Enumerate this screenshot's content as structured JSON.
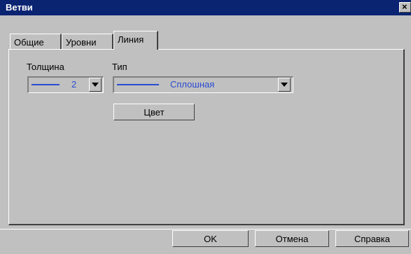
{
  "window": {
    "title": "Ветви",
    "close_glyph": "×"
  },
  "tabs": [
    {
      "label": "Общие",
      "active": false
    },
    {
      "label": "Уровни",
      "active": false
    },
    {
      "label": "Линия",
      "active": true
    }
  ],
  "line_settings": {
    "thickness_label": "Толщина",
    "thickness_value": "2",
    "type_label": "Тип",
    "type_value": "Сплошная",
    "color_button": "Цвет",
    "line_color": "#2b4bd1"
  },
  "buttons": {
    "ok": "OK",
    "cancel": "Отмена",
    "help": "Справка"
  }
}
